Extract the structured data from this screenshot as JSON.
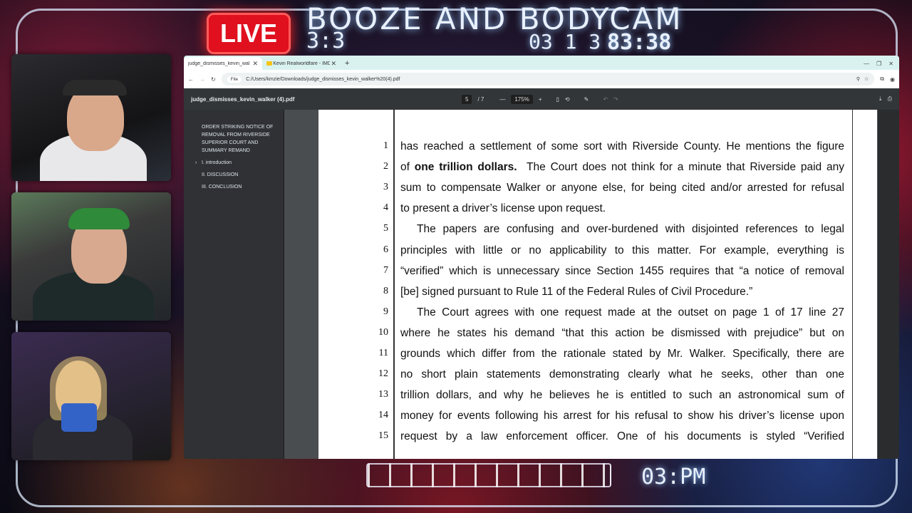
{
  "overlay": {
    "live_label": "LIVE",
    "show_title": "BOOZE AND BODYCAM",
    "clock_small": "3:3",
    "date_readout": "03 1 3",
    "time_readout": "83:38",
    "bottom_time": "03:PM"
  },
  "browser": {
    "tabs": [
      {
        "label": "judge_dismisses_kevin_walker (",
        "active": true
      },
      {
        "label": "Kevin Realworldfare - IMDb",
        "active": false
      }
    ],
    "new_tab_label": "+",
    "address_chip": "File",
    "address_url": "C:/Users/kmzie/Downloads/judge_dismisses_kevin_walker%20(4).pdf"
  },
  "pdf": {
    "filename": "judge_dismisses_kevin_walker (4).pdf",
    "page_current": "5",
    "page_total": "/ 7",
    "zoom": "175%",
    "outline": [
      {
        "label": "ORDER STRIKING NOTICE OF REMOVAL FROM RIVERSIDE SUPERIOR COURT AND SUMMARY REMAND",
        "caret": ""
      },
      {
        "label": "I. introduction",
        "caret": "›"
      },
      {
        "label": "II. DISCUSSION",
        "caret": ""
      },
      {
        "label": "III. CONCLUSION",
        "caret": ""
      }
    ],
    "lines": [
      {
        "n": "1",
        "pre": "has reached a settlement of some sort with Riverside County. He mentions the figure",
        "bold": "",
        "post": "",
        "indent": false,
        "last": false
      },
      {
        "n": "2",
        "pre": "of ",
        "bold": "one trillion dollars.",
        "post": "  The Court does not think for a minute that Riverside paid any",
        "indent": false,
        "last": false
      },
      {
        "n": "3",
        "pre": "sum to compensate Walker or anyone else, for being cited and/or arrested for refusal",
        "bold": "",
        "post": "",
        "indent": false,
        "last": false
      },
      {
        "n": "4",
        "pre": "to present a driver’s license upon request.",
        "bold": "",
        "post": "",
        "indent": false,
        "last": true
      },
      {
        "n": "5",
        "pre": "The papers are confusing and over-burdened with disjointed references to legal",
        "bold": "",
        "post": "",
        "indent": true,
        "last": false
      },
      {
        "n": "6",
        "pre": "principles with little or no applicability to this matter.  For example, everything is",
        "bold": "",
        "post": "",
        "indent": false,
        "last": false
      },
      {
        "n": "7",
        "pre": "“verified” which is unnecessary since Section 1455 requires that “a notice of removal",
        "bold": "",
        "post": "",
        "indent": false,
        "last": false
      },
      {
        "n": "8",
        "pre": "[be] signed pursuant to Rule 11 of the Federal Rules of Civil Procedure.”",
        "bold": "",
        "post": "",
        "indent": false,
        "last": true
      },
      {
        "n": "9",
        "pre": "The Court agrees with one request made at the outset on page 1 of 17 line 27",
        "bold": "",
        "post": "",
        "indent": true,
        "last": false
      },
      {
        "n": "10",
        "pre": "where he states his demand “that this action be dismissed with prejudice” but on",
        "bold": "",
        "post": "",
        "indent": false,
        "last": false
      },
      {
        "n": "11",
        "pre": "grounds which differ from the rationale stated by Mr. Walker. Specifically, there are",
        "bold": "",
        "post": "",
        "indent": false,
        "last": false
      },
      {
        "n": "12",
        "pre": "no short plain statements demonstrating clearly what he seeks, other than one",
        "bold": "",
        "post": "",
        "indent": false,
        "last": false
      },
      {
        "n": "13",
        "pre": "trillion dollars, and why he believes he is entitled to such an astronomical sum of",
        "bold": "",
        "post": "",
        "indent": false,
        "last": false
      },
      {
        "n": "14",
        "pre": "money for events following his arrest for his refusal to show his driver’s license upon",
        "bold": "",
        "post": "",
        "indent": false,
        "last": false
      },
      {
        "n": "15",
        "pre": "request by a law enforcement officer.  One of his documents is styled “Verified",
        "bold": "",
        "post": "",
        "indent": false,
        "last": false
      }
    ]
  },
  "colors": {
    "live_red": "#e0101e",
    "tab_bar": "#d9f2f0",
    "pdf_toolbar": "#323639"
  }
}
